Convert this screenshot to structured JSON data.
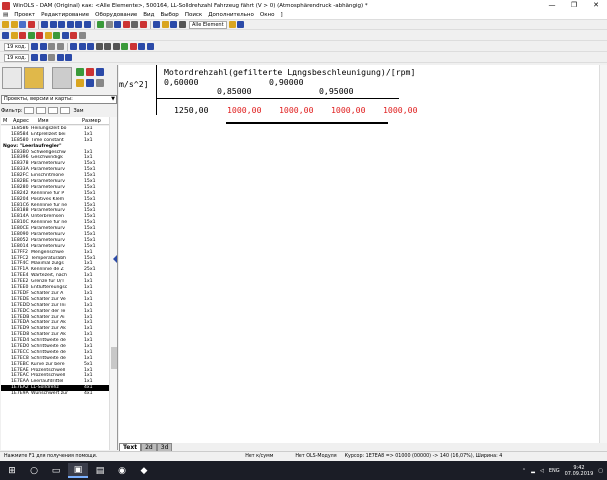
{
  "window": {
    "title": "WinOLS - DAM (Original) как: <Alle Elemente>, 500164, LL-Solldrehzahl Fahrzeug fährt (V > 0) (Atmosphärendruck -abhängig) *",
    "controls": [
      "—",
      "❐",
      "✕"
    ]
  },
  "menu": [
    "Проект",
    "Редактирование",
    "Оборудование",
    "Вид",
    "Выбор",
    "Поиск",
    "Дополнительно",
    "Окно",
    "]"
  ],
  "toolbar": {
    "element_combo": "Alle Element",
    "combo_a": "19 код.",
    "combo_b": "19 код."
  },
  "left_panel": {
    "view_select": "Проекты, версии и карты:",
    "filter_label": "Фильтр:",
    "filter_hint": "Зам",
    "columns": [
      "М",
      "Адрес",
      "Имя",
      "Размер"
    ],
    "rows": [
      {
        "addr": "1E8586",
        "name": "Heilungszeit bo",
        "size": "1x1"
      },
      {
        "addr": "1E8584",
        "name": "Entprellzeit bei",
        "size": "1x1"
      },
      {
        "addr": "1E8580",
        "name": "Time constant",
        "size": "1x1"
      },
      {
        "folder": true,
        "name": "Ngov: \"Leerlaufregler\""
      },
      {
        "addr": "1E83B0",
        "name": "Schwellgeschw",
        "size": "1x1"
      },
      {
        "addr": "1E8396",
        "name": "Geschwindigk",
        "size": "1x1"
      },
      {
        "addr": "1E8378",
        "name": "Parameterkurv",
        "size": "15x1"
      },
      {
        "addr": "1E833A",
        "name": "Parameterkurv",
        "size": "15x1"
      },
      {
        "addr": "1E82FC",
        "name": "Einschritmone",
        "size": "15x1"
      },
      {
        "addr": "1E82BE",
        "name": "Parameterkurv",
        "size": "15x1"
      },
      {
        "addr": "1E8280",
        "name": "Parameterkurv",
        "size": "15x1"
      },
      {
        "addr": "1E8242",
        "name": "Kennlinie für P",
        "size": "15x1"
      },
      {
        "addr": "1E8204",
        "name": "Positives Klem",
        "size": "15x1"
      },
      {
        "addr": "1E81C6",
        "name": "Kennlinie für ne",
        "size": "15x1"
      },
      {
        "addr": "1E8188",
        "name": "Parameterkurv",
        "size": "15x1"
      },
      {
        "addr": "1E814A",
        "name": "Unterbremsen",
        "size": "15x1"
      },
      {
        "addr": "1E810C",
        "name": "Kennlinie für ne",
        "size": "15x1"
      },
      {
        "addr": "1E80CE",
        "name": "Parameterkurv",
        "size": "15x1"
      },
      {
        "addr": "1E8090",
        "name": "Parameterkurv",
        "size": "15x1"
      },
      {
        "addr": "1E8052",
        "name": "Parameterkurv",
        "size": "15x1"
      },
      {
        "addr": "1E8014",
        "name": "Parameterkurv",
        "size": "15x1"
      },
      {
        "addr": "1E7FF2",
        "name": "Mengenschwe",
        "size": "1x1"
      },
      {
        "addr": "1E7FC2",
        "name": "Temperaturabh",
        "size": "15x1"
      },
      {
        "addr": "1E7F4C",
        "name": "Maximal zulgs",
        "size": "1x1"
      },
      {
        "addr": "1E7F1A",
        "name": "Kennlinie de Z",
        "size": "25x1"
      },
      {
        "addr": "1E7EE4",
        "name": "Wartezeit, nach",
        "size": "1x1"
      },
      {
        "addr": "1E7EE2",
        "name": "Grenze für Ü/T",
        "size": "1x1"
      },
      {
        "addr": "1E7EE0",
        "name": "Entlüftereungsc",
        "size": "1x1"
      },
      {
        "addr": "1E7EDF",
        "name": "Schalter zur A",
        "size": "1x1"
      },
      {
        "addr": "1E7EDE",
        "name": "Schalter zur Ve",
        "size": "1x1"
      },
      {
        "addr": "1E7EDD",
        "name": "Schalter zur Ini",
        "size": "1x1"
      },
      {
        "addr": "1E7EDC",
        "name": "Schalter der Te",
        "size": "1x1"
      },
      {
        "addr": "1E7EDB",
        "name": "Schalter zur Ai",
        "size": "1x1"
      },
      {
        "addr": "1E7EDA",
        "name": "Schalter zur Ak",
        "size": "1x1"
      },
      {
        "addr": "1E7ED9",
        "name": "Schalter zur Ak",
        "size": "1x1"
      },
      {
        "addr": "1E7ED8",
        "name": "Schalter zur Ak",
        "size": "1x1"
      },
      {
        "addr": "1E7ED4",
        "name": "Schrittweite de",
        "size": "1x1"
      },
      {
        "addr": "1E7ED0",
        "name": "Schrittweite de",
        "size": "1x1"
      },
      {
        "addr": "1E7ECC",
        "name": "Schrittweite de",
        "size": "1x1"
      },
      {
        "addr": "1E7EC8",
        "name": "Schrittweite de",
        "size": "1x1"
      },
      {
        "addr": "1E7EBC",
        "name": "Kurve zur bere",
        "size": "5x1"
      },
      {
        "addr": "1E7EAE",
        "name": "Prozentschwell",
        "size": "1x1"
      },
      {
        "addr": "1E7EAC",
        "name": "Prozentschwell",
        "size": "1x1"
      },
      {
        "addr": "1E7EAA",
        "name": "Leerlaufdrittel",
        "size": "1x1"
      },
      {
        "addr": "1E7EA2",
        "name": "LL-Solldrehz",
        "size": "4x1",
        "selected": true
      },
      {
        "addr": "1E7E9A",
        "name": "Wunschwert zur",
        "size": "4x1"
      }
    ]
  },
  "main": {
    "unit_fragment": "m/s^2]",
    "header_title": "Motordrehzahl(gefilterte Lдngsbeschleunigung)/[rpm]",
    "axis_row1": [
      "0,60000",
      "0,90000"
    ],
    "axis_row2": [
      "0,85000",
      "0,95000"
    ],
    "row_label": "1250,00",
    "values": [
      "1000,00",
      "1000,00",
      "1000,00",
      "1000,00"
    ]
  },
  "tabs": [
    {
      "label": "Text",
      "active": true
    },
    {
      "label": "2d",
      "active": false
    },
    {
      "label": "3d",
      "active": false
    }
  ],
  "status": {
    "hint": "Нажмите F1 для получения помощи.",
    "checksum": "Нет к/сумм",
    "module": "Нет OLS-Модуля",
    "cursor": "Курсор: 1E7EA8 => 01000 (00000) -> 140 (16,07%), Ширина: 4"
  },
  "taskbar": {
    "lang": "ENG",
    "time": "9:42",
    "date": "07.09.2019"
  },
  "colors": {
    "value_red": "#e02020",
    "taskbar": "#1b1d26",
    "selection": "#000000"
  }
}
